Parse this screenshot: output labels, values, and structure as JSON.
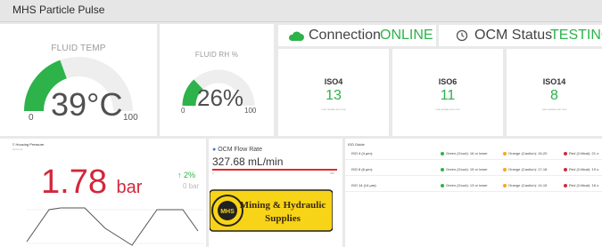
{
  "app": {
    "title": "MHS Particle Pulse"
  },
  "colors": {
    "green": "#2db34a",
    "red": "#d4263b",
    "orange": "#f5a623",
    "gauge_track": "#eeeeee"
  },
  "fluid_temp": {
    "title": "FLUID TEMP",
    "value": "39°C",
    "min": "0",
    "max": "100",
    "level": 0.39
  },
  "fluid_rh": {
    "title": "FLUID RH %",
    "value": "26%",
    "min": "0",
    "max": "100",
    "level": 0.26
  },
  "connection": {
    "label": "Connection",
    "status": "ONLINE",
    "icon": "cloud-icon"
  },
  "ocm": {
    "label": "OCM Status",
    "status": "TESTING",
    "icon": "history-icon"
  },
  "iso_cards": [
    {
      "name": "ISO4",
      "value": "13",
      "sub": "Last update just now"
    },
    {
      "name": "ISO6",
      "value": "11",
      "sub": "Last update just now"
    },
    {
      "name": "ISO14",
      "value": "8",
      "sub": "Last update just now"
    }
  ],
  "housing_pressure": {
    "title": "Housing Pressure",
    "sub": "last hour",
    "value": "1.78",
    "unit": "bar",
    "change": "2%",
    "change_bar": "0 bar"
  },
  "flow": {
    "title": "OCM Flow Rate",
    "value": "327.68 mL/min",
    "min": "0",
    "max": "300",
    "level": 1.0
  },
  "logo": {
    "text1": "Mining & Hydraulic",
    "text2": "Supplies",
    "mark": "MHS"
  },
  "iso_guide": {
    "title": "ISO Guide",
    "rows": [
      {
        "label": "ISO 4 (4 µm):",
        "good": "Green (Good): 16 or lower",
        "caution": "Orange (Caution): 15-20",
        "critical": "Red (Critical): 21 o"
      },
      {
        "label": "ISO 6 (6 µm):",
        "good": "Green (Good): 15 or lower",
        "caution": "Orange (Caution): 17-18",
        "critical": "Red (Critical): 19 o"
      },
      {
        "label": "ISO 14 (14 µm):",
        "good": "Green (Good): 13 or lower",
        "caution": "Orange (Caution): 14-15",
        "critical": "Red (Critical): 16 o"
      }
    ]
  }
}
